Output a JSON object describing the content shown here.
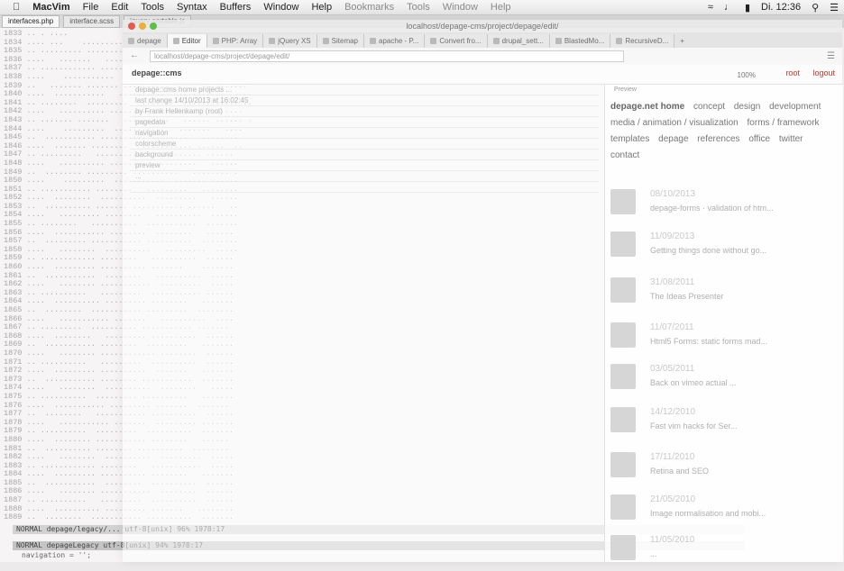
{
  "menubar": {
    "app_name": "MacVim",
    "items": [
      "File",
      "Edit",
      "Tools",
      "Syntax",
      "Buffers",
      "Window",
      "Help"
    ],
    "ghost_items": [
      "Bookmarks",
      "Tools",
      "Window",
      "Help"
    ],
    "clock": "Di. 12:36"
  },
  "vim": {
    "tabs": [
      "interfaces.php",
      "interface.scss",
      "jquery-sortable.js"
    ],
    "status_line": "NORMAL  depage/legacy/...  utf-8[unix]  96% 1978:17",
    "status_line_2": "NORMAL  depageLegacy  utf-8[unix]  94% 1978:17",
    "cmdline": "navigation = '';"
  },
  "browser": {
    "title": "localhost/depage-cms/project/depage/edit/",
    "tabs": [
      {
        "label": "depage"
      },
      {
        "label": "Editor"
      },
      {
        "label": "PHP: Array"
      },
      {
        "label": "jQuery XS"
      },
      {
        "label": "Sitemap"
      },
      {
        "label": "apache - P..."
      },
      {
        "label": "Convert fro..."
      },
      {
        "label": "drupal_sett..."
      },
      {
        "label": "BlastedMo..."
      },
      {
        "label": "RecursiveD..."
      }
    ],
    "url": "localhost/depage-cms/project/depage/edit/",
    "zoom": "100%"
  },
  "admin": {
    "logo": "depage::cms",
    "links": [
      "root",
      "logout"
    ]
  },
  "middle_rows": [
    "depage::cms    home    projects    ...",
    "last change       14/10/2013 at 16:02:45",
    "                  by Frank Hellenkamp (root)",
    "pagedata",
    "  navigation",
    "  colorscheme",
    "  background",
    "  preview",
    "    ...",
    ""
  ],
  "preview": {
    "label": "Preview",
    "nav": [
      "depage.net home",
      "concept",
      "design",
      "development",
      "media / animation / visualization",
      "forms / framework",
      "templates",
      "depage",
      "references",
      "office",
      "twitter",
      "contact"
    ],
    "entries": [
      {
        "date": "08/10/2013",
        "title": "depage-forms · validation of htm..."
      },
      {
        "date": "11/09/2013",
        "title": "Getting things done without go..."
      },
      {
        "date": "31/08/2011",
        "title": "The Ideas Presenter"
      },
      {
        "date": "11/07/2011",
        "title": "Html5 Forms: static forms mad..."
      },
      {
        "date": "03/05/2011",
        "title": "Back on vimeo actual ..."
      },
      {
        "date": "14/12/2010",
        "title": "Fast vim hacks for Ser..."
      },
      {
        "date": "17/11/2010",
        "title": "Retina and SEO"
      },
      {
        "date": "21/05/2010",
        "title": "Image normalisation and mobi..."
      },
      {
        "date": "11/05/2010",
        "title": "..."
      }
    ]
  }
}
